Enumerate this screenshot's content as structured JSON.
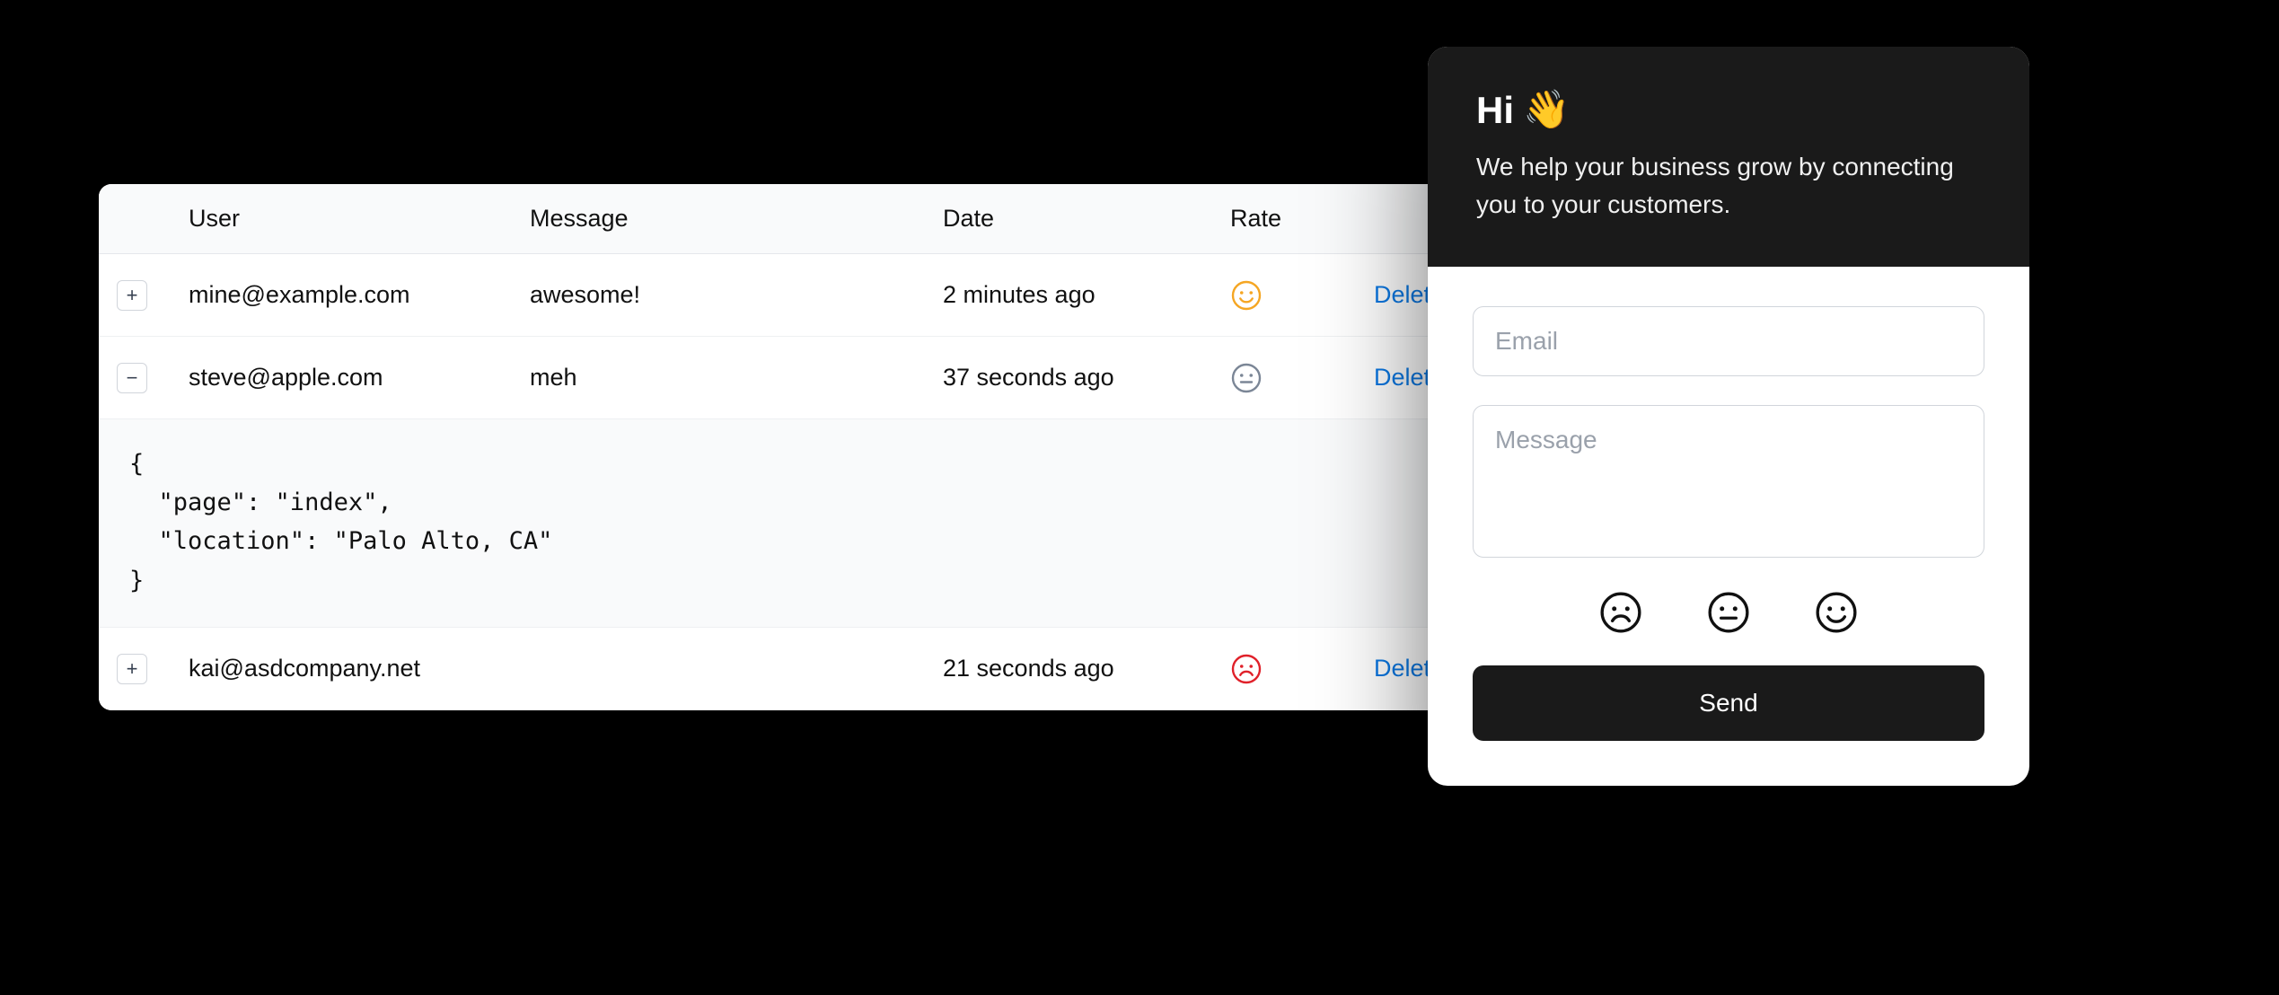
{
  "table": {
    "headers": {
      "user": "User",
      "message": "Message",
      "date": "Date",
      "rate": "Rate"
    },
    "delete_label": "Delete",
    "rows": [
      {
        "expand_glyph": "+",
        "user": "mine@example.com",
        "message": "awesome!",
        "date": "2 minutes ago",
        "rate": "happy"
      },
      {
        "expand_glyph": "−",
        "user": "steve@apple.com",
        "message": "meh",
        "date": "37 seconds ago",
        "rate": "neutral"
      },
      {
        "expand_glyph": "+",
        "user": "kai@asdcompany.net",
        "message": "",
        "date": "21 seconds ago",
        "rate": "sad"
      }
    ],
    "expanded_json": "{\n  \"page\": \"index\",\n  \"location\": \"Palo Alto, CA\"\n}"
  },
  "widget": {
    "greeting_text": "Hi",
    "greeting_emoji": "👋",
    "tagline": "We help your business grow by connecting you to your customers.",
    "email_placeholder": "Email",
    "message_placeholder": "Message",
    "send_label": "Send"
  },
  "colors": {
    "link": "#0b78e3",
    "happy": "#f5a623",
    "neutral": "#7b8696",
    "sad": "#e0212a",
    "dark": "#1a1a1a"
  }
}
